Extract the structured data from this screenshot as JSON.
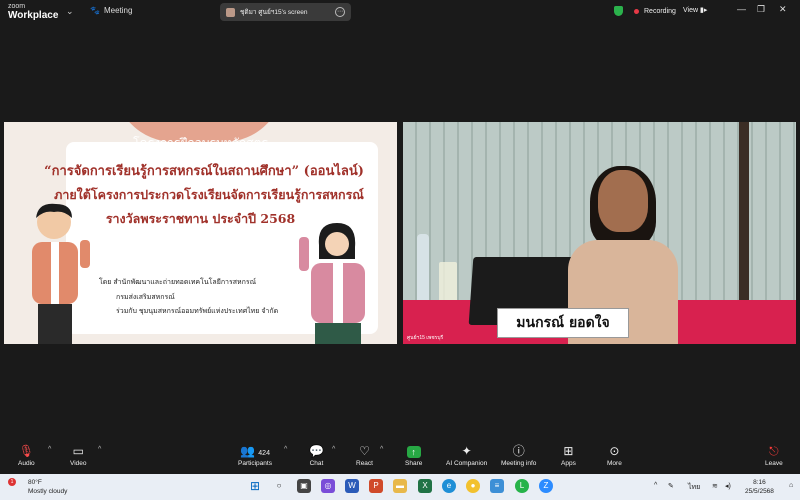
{
  "app": {
    "logo_line1": "zoom",
    "logo_line2": "Workplace",
    "meeting_label": "Meeting"
  },
  "share_pill": {
    "text": "ชุติมา ศูนย์ฯ15's screen"
  },
  "status": {
    "recording": "Recording",
    "view": "View"
  },
  "slide": {
    "title_small": "โครงการฝึกอบรมหลักสูตร",
    "title_line1": "“การจัดการเรียนรู้การสหกรณ์ในสถานศึกษา” (ออนไลน์)",
    "title_line2": "ภายใต้โครงการประกวดโรงเรียนจัดการเรียนรู้การสหกรณ์",
    "title_line3": "รางวัลพระราชทาน ประจำปี 2568",
    "sub1": "โดย สำนักพัฒนาและถ่ายทอดเทคโนโลยีการสหกรณ์",
    "sub2": "กรมส่งเสริมสหกรณ์",
    "sub3": "ร่วมกับ ชุมนุมสหกรณ์ออมทรัพย์แห่งประเทศไทย จำกัด"
  },
  "video": {
    "nameplate": "มนกรณ์ ยอดใจ",
    "participant_label": "ศูนย์ฯ15 เพชรบุรี"
  },
  "toolbar": {
    "audio": "Audio",
    "video": "Video",
    "participants": "Participants",
    "participants_count": "424",
    "chat": "Chat",
    "react": "React",
    "share": "Share",
    "ai": "AI Companion",
    "meeting_info": "Meeting info",
    "apps": "Apps",
    "more": "More",
    "leave": "Leave"
  },
  "taskbar": {
    "weather_temp": "80°F",
    "weather_desc": "Mostly cloudy",
    "weather_badge": "1",
    "lang": "ไทย",
    "time": "8:16",
    "date": "25/5/2568"
  },
  "colors": {
    "share_green": "#27a844",
    "leave_red": "#ff3b3b",
    "record_red": "#e63946",
    "title_red": "#a0312a"
  },
  "icons": [
    "chevron-down-icon",
    "paw-icon",
    "shield-icon",
    "mic-muted-icon",
    "camera-icon",
    "people-icon",
    "chat-icon",
    "heart-icon",
    "share-up-icon",
    "sparkle-icon",
    "info-icon",
    "apps-icon",
    "more-icon",
    "leave-icon"
  ]
}
